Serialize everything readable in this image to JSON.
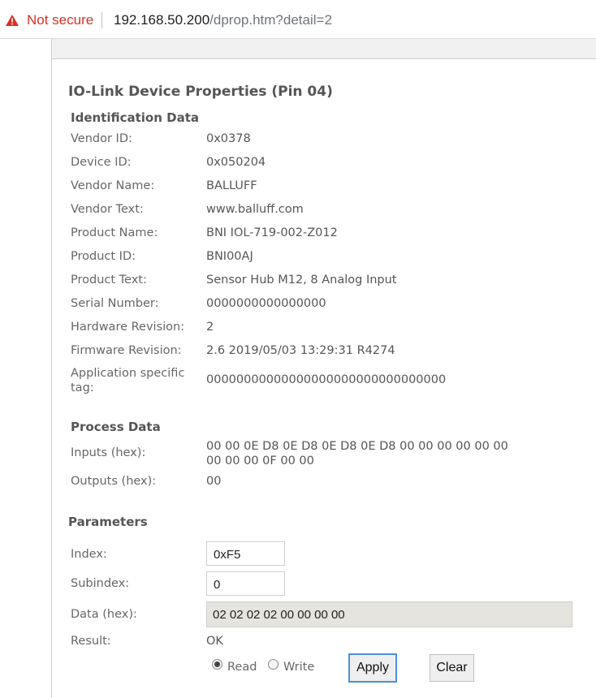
{
  "browser": {
    "security_label": "Not secure",
    "url_host": "192.168.50.200",
    "url_path": "/dprop.htm?detail=2"
  },
  "page": {
    "title": "IO-Link Device Properties (Pin 04)"
  },
  "identification": {
    "heading": "Identification Data",
    "rows": [
      {
        "label": "Vendor ID:",
        "value": "0x0378"
      },
      {
        "label": "Device ID:",
        "value": "0x050204"
      },
      {
        "label": "Vendor Name:",
        "value": "BALLUFF"
      },
      {
        "label": "Vendor Text:",
        "value": "www.balluff.com"
      },
      {
        "label": "Product Name:",
        "value": "BNI IOL-719-002-Z012"
      },
      {
        "label": "Product ID:",
        "value": "BNI00AJ"
      },
      {
        "label": "Product Text:",
        "value": "Sensor Hub M12, 8 Analog Input"
      },
      {
        "label": "Serial Number:",
        "value": "0000000000000000"
      },
      {
        "label": "Hardware Revision:",
        "value": "2"
      },
      {
        "label": "Firmware Revision:",
        "value": "2.6 2019/05/03 13:29:31 R4274"
      }
    ],
    "app_tag_label_line1": "Application specific",
    "app_tag_label_line2": "tag:",
    "app_tag_value": "00000000000000000000000000000000"
  },
  "process": {
    "heading": "Process Data",
    "inputs_label": "Inputs (hex):",
    "inputs_value_line1": "00 00 0E D8 0E D8 0E D8 0E D8 00 00 00 00 00 00",
    "inputs_value_line2": "00 00 00 0F 00 00",
    "outputs_label": "Outputs (hex):",
    "outputs_value": "00"
  },
  "parameters": {
    "heading": "Parameters",
    "index_label": "Index:",
    "index_value": "0xF5",
    "subindex_label": "Subindex:",
    "subindex_value": "0",
    "data_label": "Data (hex):",
    "data_value": "02 02 02 02 00 00 00 00",
    "result_label": "Result:",
    "result_value": "OK",
    "read_label": "Read",
    "write_label": "Write",
    "selected_mode": "Read",
    "apply_label": "Apply",
    "clear_label": "Clear"
  }
}
